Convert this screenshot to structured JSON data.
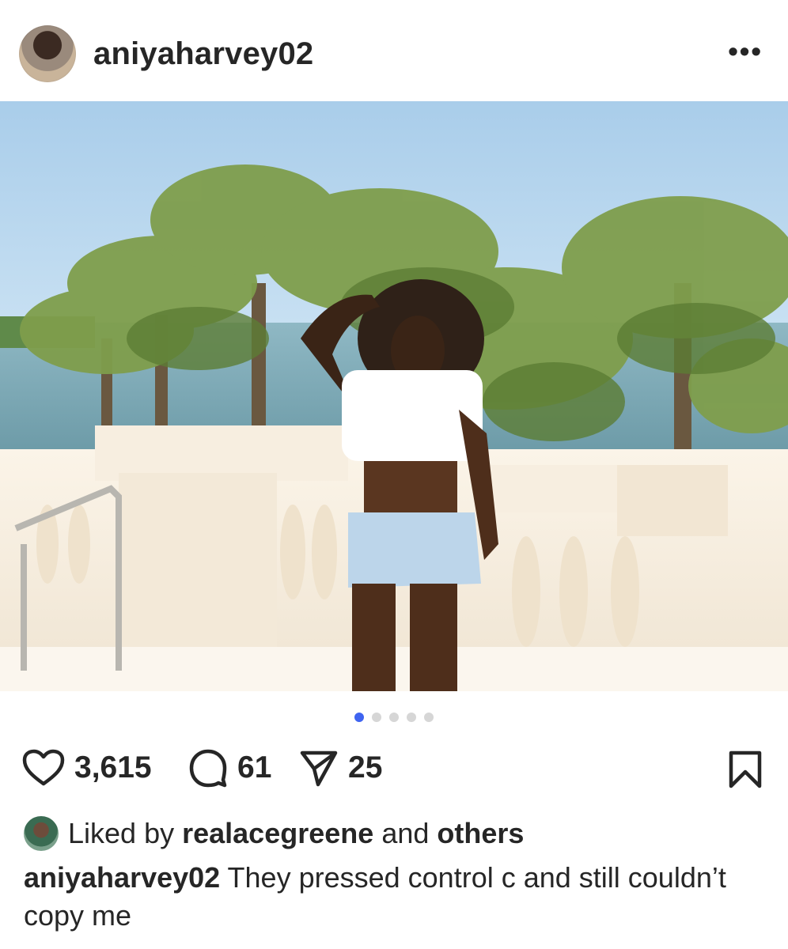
{
  "post": {
    "username": "aniyaharvey02",
    "more_label": "•••"
  },
  "carousel": {
    "total": 5,
    "active_index": 0
  },
  "actions": {
    "likes": "3,615",
    "comments": "61",
    "shares": "25"
  },
  "liked_by": {
    "prefix": "Liked by",
    "user": "realacegreene",
    "middle": "and",
    "suffix": "others"
  },
  "caption": {
    "username": "aniyaharvey02",
    "text": "They pressed control c and still couldn’t copy me"
  },
  "colors": {
    "accent_dot": "#3f64f0",
    "inactive_dot": "#d6d6d6",
    "text": "#262626"
  }
}
